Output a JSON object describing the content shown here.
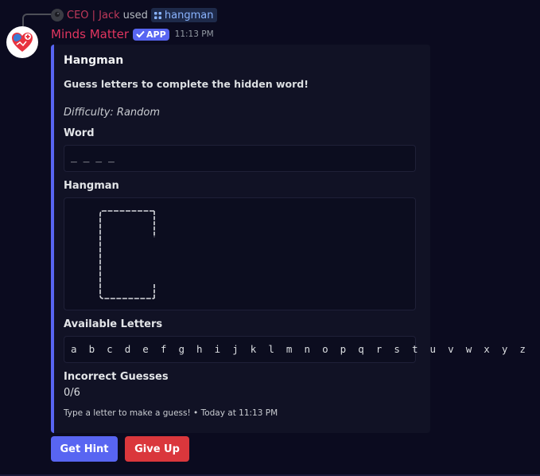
{
  "reply": {
    "user": "CEO | Jack",
    "used_text": "used",
    "command": "hangman"
  },
  "message": {
    "bot_name": "Minds Matter",
    "app_badge": "APP",
    "timestamp": "11:13 PM"
  },
  "embed": {
    "accent_color": "#5865f2",
    "title": "Hangman",
    "description": "Guess letters to complete the hidden word!",
    "difficulty": "Difficulty: Random",
    "fields": {
      "word_label": "Word",
      "word_value": "_ _ _ _",
      "hangman_label": "Hangman",
      "letters_label": "Available Letters",
      "letters_value": "a  b  c  d  e  f  g  h  i  j  k  l  m  n  o  p  q  r  s  t  u  v  w  x  y  z",
      "incorrect_label": "Incorrect Guesses",
      "incorrect_value": "0/6"
    },
    "footer": "Type a letter to make a guess! • Today at 11:13 PM"
  },
  "buttons": {
    "hint_label": "Get Hint",
    "give_up_label": "Give Up"
  },
  "colors": {
    "background": "#0b0b1f",
    "primary_button": "#5865f2",
    "danger_button": "#da373c",
    "bot_name": "#e0355f"
  }
}
